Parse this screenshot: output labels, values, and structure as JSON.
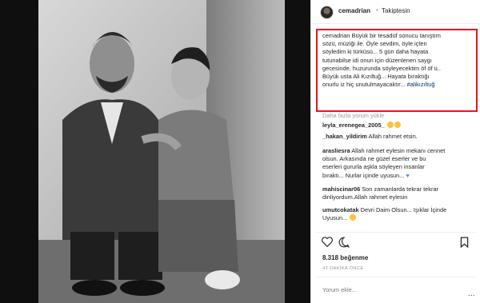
{
  "post": {
    "username": "cemadrian",
    "separator": "•",
    "follow_status": "Takiptesin",
    "caption_lines": [
      "cemadrian Büyük bir tesadüf sonucu tanıştım",
      "sözü, müziği ile. Öyle sevdim, öyle içten",
      "söyledim ki türküsü... 5 gün daha hayata",
      "tutunabilse idi onun için düzenlenen saygı",
      "gecesinde, huzurunda söyleyecektim öf öf ü..",
      "Büyük usta Ali Kızıltuğ... Hayata bıraktığı",
      "onurlu iz hiç unutulmayacaktır..."
    ],
    "hashtag": "#alikızıltuğ",
    "load_more": "Daha fazla yorum yükle",
    "likes": "8.318 beğenme",
    "date": "42 DAKİKA ÖNCE",
    "comment_placeholder": "Yorum ekle...",
    "menu": "..."
  },
  "comments": [
    {
      "user": "leyla_erenegea_2005_",
      "lines": []
    },
    {
      "user": "_hakan_yildirim",
      "lines": [
        "Allah rahmet etsin."
      ]
    },
    {
      "user": "arasliesra",
      "lines": [
        "Allah rahmet eylesin mekanı cennet",
        "olsun. Arkasında ne güzel eserler ve bu",
        "eserleri gururla aşkla söyleyen insanlar",
        "bıraktı... Nurlar içinde uyusun..."
      ]
    },
    {
      "user": "mahiscinar06",
      "lines": [
        "Son zamanlarda tekrar tekrar",
        "dinliyordum.Allah rahmet eylesin"
      ]
    },
    {
      "user": "umutcokatak",
      "lines": [
        "Devri Daim Olsun... Işıklar İçinde",
        "Uyusun..."
      ]
    }
  ],
  "colors": {
    "highlight_border": "#e8141e",
    "link": "#003569",
    "muted": "#999999"
  }
}
